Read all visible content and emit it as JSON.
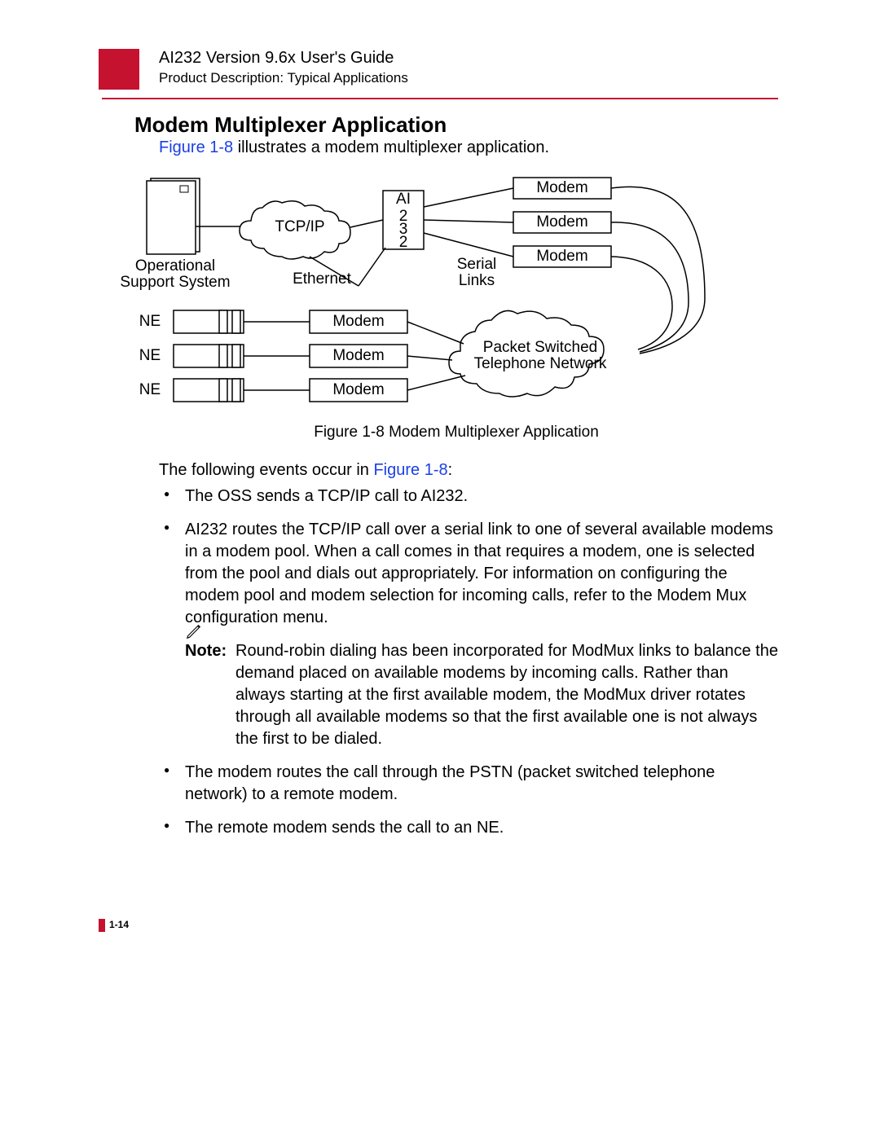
{
  "header": {
    "title": "AI232 Version 9.6x User's Guide",
    "subtitle": "Product Description: Typical Applications"
  },
  "section_title": "Modem Multiplexer Application",
  "intro_link": "Figure 1-8",
  "intro_rest": " illustrates a modem multiplexer application.",
  "diagram": {
    "oss_line1": "Operational",
    "oss_line2": "Support System",
    "tcpip": "TCP/IP",
    "ethernet": "Ethernet",
    "ai": "AI",
    "ai_num1": "2",
    "ai_num2": "3",
    "ai_num3": "2",
    "serial_line1": "Serial",
    "serial_line2": "Links",
    "modem_top1": "Modem",
    "modem_top2": "Modem",
    "modem_top3": "Modem",
    "pstn_line1": "Packet Switched",
    "pstn_line2": "Telephone Network",
    "ne1": "NE",
    "ne2": "NE",
    "ne3": "NE",
    "modem_bot1": "Modem",
    "modem_bot2": "Modem",
    "modem_bot3": "Modem"
  },
  "caption": "Figure 1-8   Modem Multiplexer Application",
  "following_text": "The following events occur in ",
  "following_link": "Figure 1-8",
  "following_colon": ":",
  "bullets": {
    "b1": "The OSS sends a TCP/IP call to AI232.",
    "b2": "AI232 routes the TCP/IP call over a serial link to one of several available modems in a modem pool. When a call comes in that requires a modem, one is selected from the pool and dials out appropriately. For information on configuring the modem pool and modem selection for incoming calls, refer to the Modem Mux configuration menu.",
    "note_label": "Note:",
    "note_body": "Round-robin dialing has been incorporated for ModMux links to balance the demand placed on available modems by incoming calls. Rather than always starting at the first available modem, the ModMux driver rotates through all available modems so that the first available one is not always the first to be dialed.",
    "b3": "The modem routes the call through the PSTN (packet switched telephone network) to a remote modem.",
    "b4": "The remote modem sends the call to an NE."
  },
  "page_number": "1-14"
}
